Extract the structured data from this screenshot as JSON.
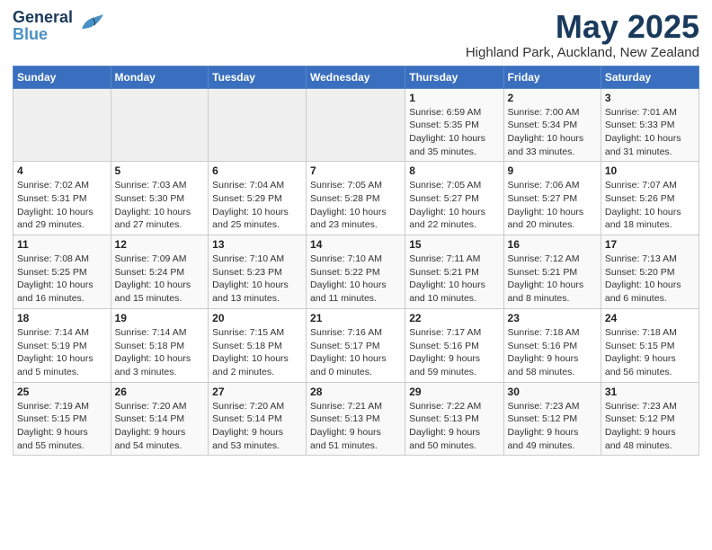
{
  "header": {
    "logo_line1": "General",
    "logo_line2": "Blue",
    "month": "May 2025",
    "location": "Highland Park, Auckland, New Zealand"
  },
  "days_of_week": [
    "Sunday",
    "Monday",
    "Tuesday",
    "Wednesday",
    "Thursday",
    "Friday",
    "Saturday"
  ],
  "weeks": [
    [
      {
        "num": "",
        "info": "",
        "empty": true
      },
      {
        "num": "",
        "info": "",
        "empty": true
      },
      {
        "num": "",
        "info": "",
        "empty": true
      },
      {
        "num": "",
        "info": "",
        "empty": true
      },
      {
        "num": "1",
        "info": "Sunrise: 6:59 AM\nSunset: 5:35 PM\nDaylight: 10 hours\nand 35 minutes."
      },
      {
        "num": "2",
        "info": "Sunrise: 7:00 AM\nSunset: 5:34 PM\nDaylight: 10 hours\nand 33 minutes."
      },
      {
        "num": "3",
        "info": "Sunrise: 7:01 AM\nSunset: 5:33 PM\nDaylight: 10 hours\nand 31 minutes."
      }
    ],
    [
      {
        "num": "4",
        "info": "Sunrise: 7:02 AM\nSunset: 5:31 PM\nDaylight: 10 hours\nand 29 minutes."
      },
      {
        "num": "5",
        "info": "Sunrise: 7:03 AM\nSunset: 5:30 PM\nDaylight: 10 hours\nand 27 minutes."
      },
      {
        "num": "6",
        "info": "Sunrise: 7:04 AM\nSunset: 5:29 PM\nDaylight: 10 hours\nand 25 minutes."
      },
      {
        "num": "7",
        "info": "Sunrise: 7:05 AM\nSunset: 5:28 PM\nDaylight: 10 hours\nand 23 minutes."
      },
      {
        "num": "8",
        "info": "Sunrise: 7:05 AM\nSunset: 5:27 PM\nDaylight: 10 hours\nand 22 minutes."
      },
      {
        "num": "9",
        "info": "Sunrise: 7:06 AM\nSunset: 5:27 PM\nDaylight: 10 hours\nand 20 minutes."
      },
      {
        "num": "10",
        "info": "Sunrise: 7:07 AM\nSunset: 5:26 PM\nDaylight: 10 hours\nand 18 minutes."
      }
    ],
    [
      {
        "num": "11",
        "info": "Sunrise: 7:08 AM\nSunset: 5:25 PM\nDaylight: 10 hours\nand 16 minutes."
      },
      {
        "num": "12",
        "info": "Sunrise: 7:09 AM\nSunset: 5:24 PM\nDaylight: 10 hours\nand 15 minutes."
      },
      {
        "num": "13",
        "info": "Sunrise: 7:10 AM\nSunset: 5:23 PM\nDaylight: 10 hours\nand 13 minutes."
      },
      {
        "num": "14",
        "info": "Sunrise: 7:10 AM\nSunset: 5:22 PM\nDaylight: 10 hours\nand 11 minutes."
      },
      {
        "num": "15",
        "info": "Sunrise: 7:11 AM\nSunset: 5:21 PM\nDaylight: 10 hours\nand 10 minutes."
      },
      {
        "num": "16",
        "info": "Sunrise: 7:12 AM\nSunset: 5:21 PM\nDaylight: 10 hours\nand 8 minutes."
      },
      {
        "num": "17",
        "info": "Sunrise: 7:13 AM\nSunset: 5:20 PM\nDaylight: 10 hours\nand 6 minutes."
      }
    ],
    [
      {
        "num": "18",
        "info": "Sunrise: 7:14 AM\nSunset: 5:19 PM\nDaylight: 10 hours\nand 5 minutes."
      },
      {
        "num": "19",
        "info": "Sunrise: 7:14 AM\nSunset: 5:18 PM\nDaylight: 10 hours\nand 3 minutes."
      },
      {
        "num": "20",
        "info": "Sunrise: 7:15 AM\nSunset: 5:18 PM\nDaylight: 10 hours\nand 2 minutes."
      },
      {
        "num": "21",
        "info": "Sunrise: 7:16 AM\nSunset: 5:17 PM\nDaylight: 10 hours\nand 0 minutes."
      },
      {
        "num": "22",
        "info": "Sunrise: 7:17 AM\nSunset: 5:16 PM\nDaylight: 9 hours\nand 59 minutes."
      },
      {
        "num": "23",
        "info": "Sunrise: 7:18 AM\nSunset: 5:16 PM\nDaylight: 9 hours\nand 58 minutes."
      },
      {
        "num": "24",
        "info": "Sunrise: 7:18 AM\nSunset: 5:15 PM\nDaylight: 9 hours\nand 56 minutes."
      }
    ],
    [
      {
        "num": "25",
        "info": "Sunrise: 7:19 AM\nSunset: 5:15 PM\nDaylight: 9 hours\nand 55 minutes."
      },
      {
        "num": "26",
        "info": "Sunrise: 7:20 AM\nSunset: 5:14 PM\nDaylight: 9 hours\nand 54 minutes."
      },
      {
        "num": "27",
        "info": "Sunrise: 7:20 AM\nSunset: 5:14 PM\nDaylight: 9 hours\nand 53 minutes."
      },
      {
        "num": "28",
        "info": "Sunrise: 7:21 AM\nSunset: 5:13 PM\nDaylight: 9 hours\nand 51 minutes."
      },
      {
        "num": "29",
        "info": "Sunrise: 7:22 AM\nSunset: 5:13 PM\nDaylight: 9 hours\nand 50 minutes."
      },
      {
        "num": "30",
        "info": "Sunrise: 7:23 AM\nSunset: 5:12 PM\nDaylight: 9 hours\nand 49 minutes."
      },
      {
        "num": "31",
        "info": "Sunrise: 7:23 AM\nSunset: 5:12 PM\nDaylight: 9 hours\nand 48 minutes."
      }
    ]
  ]
}
